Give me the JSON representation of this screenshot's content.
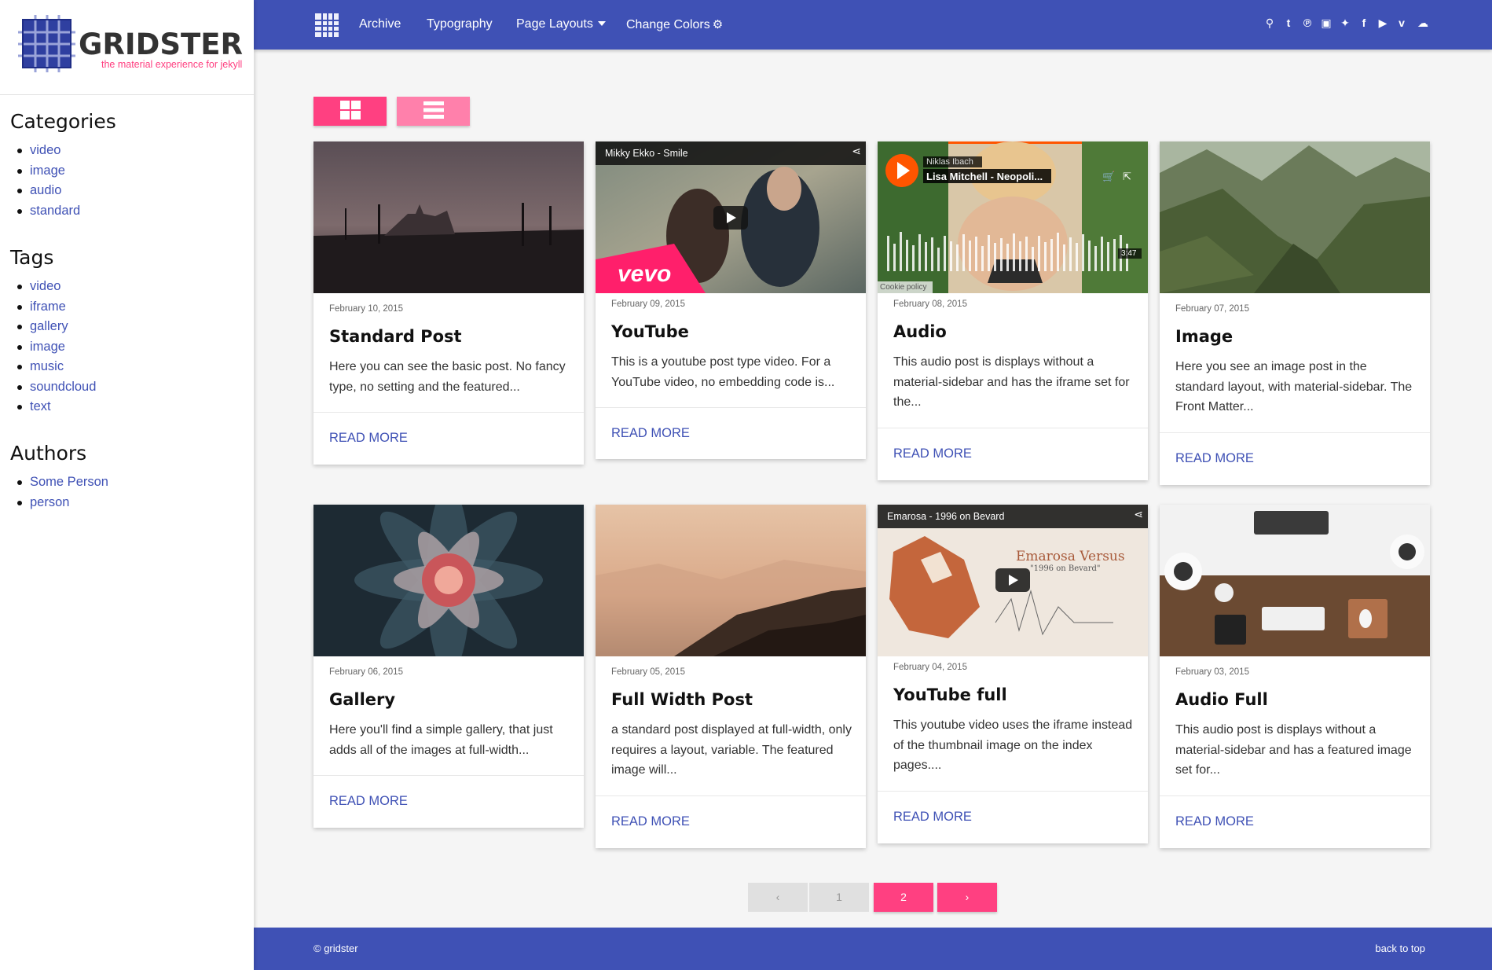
{
  "brand": {
    "name": "GRIDSTER",
    "tagline": "the material experience for jekyll"
  },
  "nav": {
    "archive": "Archive",
    "typography": "Typography",
    "page_layouts": "Page Layouts",
    "change_colors": "Change Colors",
    "social_icons": [
      "search-icon",
      "tumblr-icon",
      "pinterest-icon",
      "instagram-icon",
      "twitter-icon",
      "facebook-icon",
      "youtube-icon",
      "vimeo-icon",
      "soundcloud-icon"
    ]
  },
  "sidebar": {
    "categories_title": "Categories",
    "categories": [
      "video",
      "image",
      "audio",
      "standard"
    ],
    "tags_title": "Tags",
    "tags": [
      "video",
      "iframe",
      "gallery",
      "image",
      "music",
      "soundcloud",
      "text"
    ],
    "authors_title": "Authors",
    "authors": [
      "Some Person",
      "person"
    ]
  },
  "posts": [
    {
      "date": "February 10, 2015",
      "title": "Standard Post",
      "excerpt": "Here you can see the basic post. No fancy type, no setting and the featured...",
      "read_more": "READ MORE"
    },
    {
      "date": "February 09, 2015",
      "title": "YouTube",
      "excerpt": "This is a youtube post type video. For a YouTube video, no embedding code is...",
      "read_more": "READ MORE",
      "video_title": "Mikky Ekko - Smile",
      "video_logo": "vevo"
    },
    {
      "date": "February 08, 2015",
      "title": "Audio",
      "excerpt": "This audio post is displays without a material-sidebar and has the iframe set for the...",
      "read_more": "READ MORE",
      "artist": "Niklas Ibach",
      "track": "Lisa Mitchell - Neopoli...",
      "duration": "3:47",
      "cookie": "Cookie policy"
    },
    {
      "date": "February 07, 2015",
      "title": "Image",
      "excerpt": "Here you see an image post in the standard layout, with material-sidebar. The Front Matter...",
      "read_more": "READ MORE"
    },
    {
      "date": "February 06, 2015",
      "title": "Gallery",
      "excerpt": "Here you'll find a simple gallery, that just adds all of the images at full-width...",
      "read_more": "READ MORE"
    },
    {
      "date": "February 05, 2015",
      "title": "Full Width Post",
      "excerpt": "a standard post displayed at full-width, only requires a layout, variable. The featured image will...",
      "read_more": "READ MORE"
    },
    {
      "date": "February 04, 2015",
      "title": "YouTube full",
      "excerpt": "This youtube video uses the iframe instead of the thumbnail image on the index pages....",
      "read_more": "READ MORE",
      "video_title": "Emarosa - 1996 on Bevard",
      "video_caption": "Emarosa Versus",
      "video_subcaption": "\"1996 on Bevard\""
    },
    {
      "date": "February 03, 2015",
      "title": "Audio Full",
      "excerpt": "This audio post is displays without a material-sidebar and has a featured image set for...",
      "read_more": "READ MORE"
    }
  ],
  "pagination": {
    "prev": "‹",
    "pages": [
      "1",
      "2"
    ],
    "current": "2",
    "next": "›"
  },
  "footer": {
    "copyright": "© gridster",
    "back_to_top": "back to top"
  },
  "colors": {
    "primary": "#3f51b5",
    "accent": "#ff4081",
    "accent_light": "#ff80ab"
  }
}
